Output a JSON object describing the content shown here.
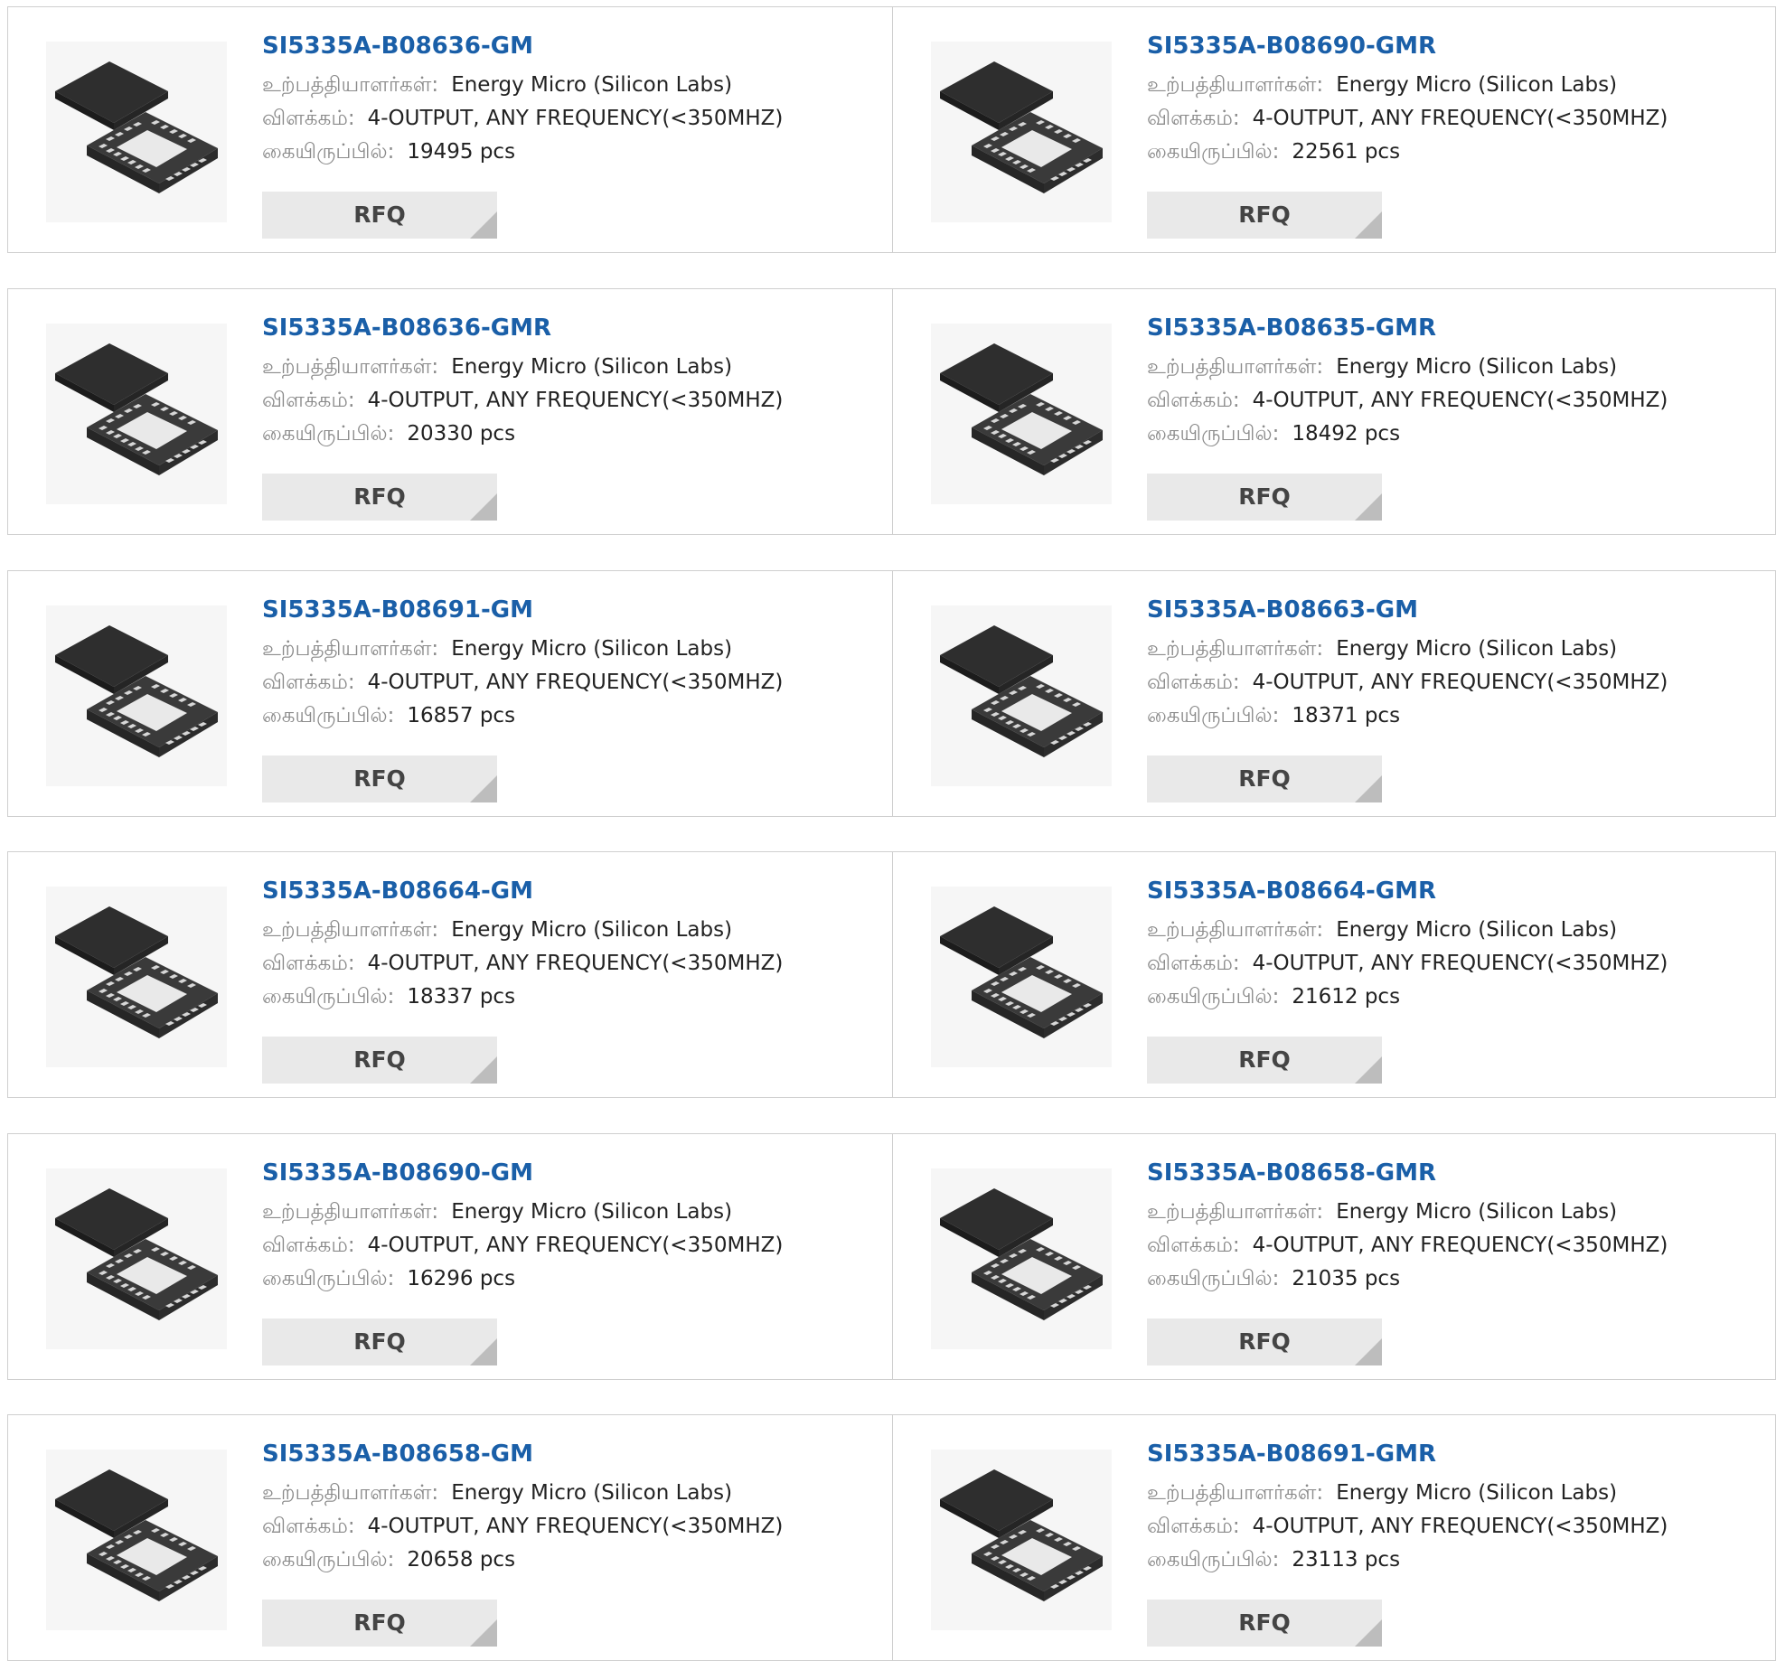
{
  "labels": {
    "manufacturer": "உற்பத்தியாளர்கள்:",
    "description": "விளக்கம்:",
    "stock": "கையிருப்பில்:",
    "rfq": "RFQ"
  },
  "colors": {
    "part_number": "#1a5fa8",
    "rfq_bg": "#e9e9e9",
    "border": "#cfcfcf"
  },
  "image_icon": "qfn-chip-package-icon",
  "products": [
    {
      "part": "SI5335A-B08636-GM",
      "manufacturer": "Energy Micro (Silicon Labs)",
      "description": "4-OUTPUT, ANY FREQUENCY(<350MHZ)",
      "stock": "19495 pcs"
    },
    {
      "part": "SI5335A-B08690-GMR",
      "manufacturer": "Energy Micro (Silicon Labs)",
      "description": "4-OUTPUT, ANY FREQUENCY(<350MHZ)",
      "stock": "22561 pcs"
    },
    {
      "part": "SI5335A-B08636-GMR",
      "manufacturer": "Energy Micro (Silicon Labs)",
      "description": "4-OUTPUT, ANY FREQUENCY(<350MHZ)",
      "stock": "20330 pcs"
    },
    {
      "part": "SI5335A-B08635-GMR",
      "manufacturer": "Energy Micro (Silicon Labs)",
      "description": "4-OUTPUT, ANY FREQUENCY(<350MHZ)",
      "stock": "18492 pcs"
    },
    {
      "part": "SI5335A-B08691-GM",
      "manufacturer": "Energy Micro (Silicon Labs)",
      "description": "4-OUTPUT, ANY FREQUENCY(<350MHZ)",
      "stock": "16857 pcs"
    },
    {
      "part": "SI5335A-B08663-GM",
      "manufacturer": "Energy Micro (Silicon Labs)",
      "description": "4-OUTPUT, ANY FREQUENCY(<350MHZ)",
      "stock": "18371 pcs"
    },
    {
      "part": "SI5335A-B08664-GM",
      "manufacturer": "Energy Micro (Silicon Labs)",
      "description": "4-OUTPUT, ANY FREQUENCY(<350MHZ)",
      "stock": "18337 pcs"
    },
    {
      "part": "SI5335A-B08664-GMR",
      "manufacturer": "Energy Micro (Silicon Labs)",
      "description": "4-OUTPUT, ANY FREQUENCY(<350MHZ)",
      "stock": "21612 pcs"
    },
    {
      "part": "SI5335A-B08690-GM",
      "manufacturer": "Energy Micro (Silicon Labs)",
      "description": "4-OUTPUT, ANY FREQUENCY(<350MHZ)",
      "stock": "16296 pcs"
    },
    {
      "part": "SI5335A-B08658-GMR",
      "manufacturer": "Energy Micro (Silicon Labs)",
      "description": "4-OUTPUT, ANY FREQUENCY(<350MHZ)",
      "stock": "21035 pcs"
    },
    {
      "part": "SI5335A-B08658-GM",
      "manufacturer": "Energy Micro (Silicon Labs)",
      "description": "4-OUTPUT, ANY FREQUENCY(<350MHZ)",
      "stock": "20658 pcs"
    },
    {
      "part": "SI5335A-B08691-GMR",
      "manufacturer": "Energy Micro (Silicon Labs)",
      "description": "4-OUTPUT, ANY FREQUENCY(<350MHZ)",
      "stock": "23113 pcs"
    }
  ]
}
